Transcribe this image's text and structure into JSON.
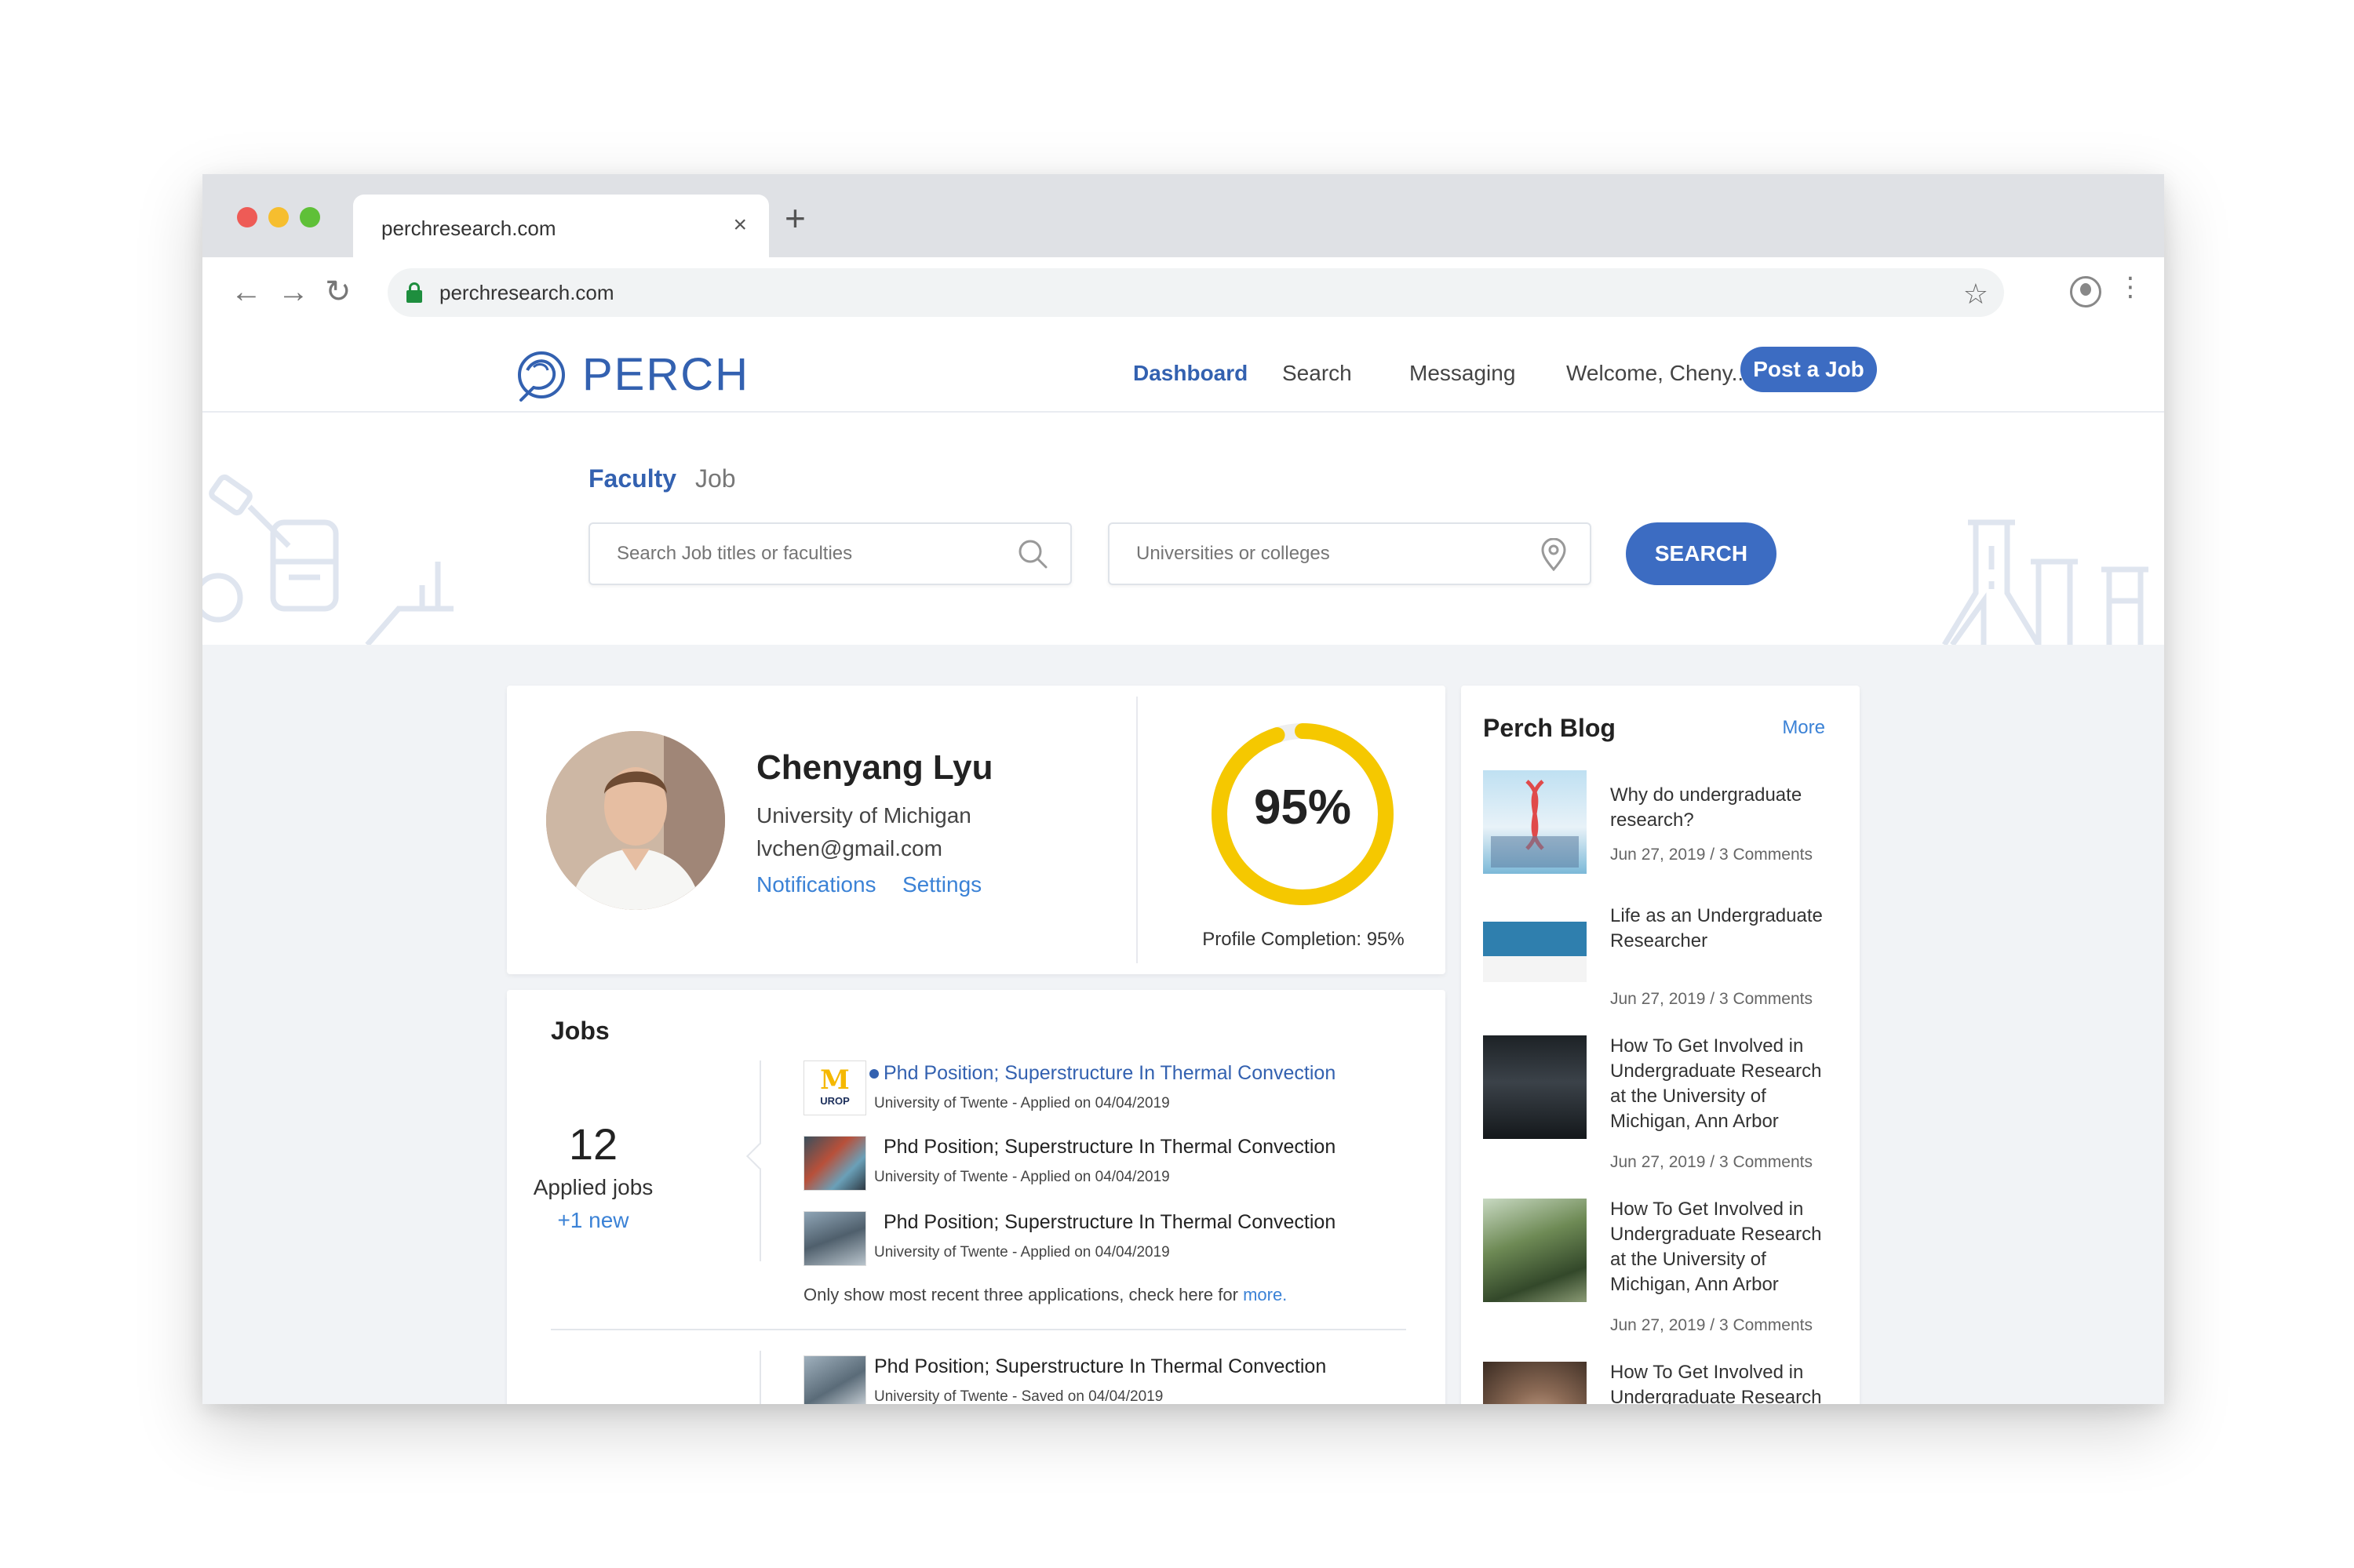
{
  "browser": {
    "tab_title": "perchresearch.com",
    "tab_close": "×",
    "new_tab": "+",
    "url": "perchresearch.com"
  },
  "header": {
    "logo_text": "PERCH",
    "nav": {
      "dashboard": "Dashboard",
      "search": "Search",
      "messaging": "Messaging",
      "welcome": "Welcome, Cheny..."
    },
    "post_job": "Post a Job"
  },
  "search": {
    "tab_faculty": "Faculty",
    "tab_job": "Job",
    "query_placeholder": "Search Job titles or faculties",
    "location_placeholder": "Universities or colleges",
    "button": "SEARCH"
  },
  "profile": {
    "name": "Chenyang Lyu",
    "university": "University of Michigan",
    "email": "lvchen@gmail.com",
    "notifications": "Notifications",
    "settings": "Settings",
    "completion_percent": 95,
    "completion_display": "95%",
    "completion_label": "Profile Completion: 95%"
  },
  "jobs": {
    "title": "Jobs",
    "applied_count": "12",
    "applied_label": "Applied jobs",
    "new_label": "+1 new",
    "applied": [
      {
        "title": "Phd Position; Superstructure In Thermal Convection",
        "meta": "University of Twente - Applied on 04/04/2019",
        "unread": true,
        "logo_text": "M",
        "logo_sub": "UROP"
      },
      {
        "title": "Phd Position; Superstructure In Thermal Convection",
        "meta": "University of Twente - Applied on 04/04/2019",
        "unread": false
      },
      {
        "title": "Phd Position; Superstructure In Thermal Convection",
        "meta": "University of Twente - Applied on 04/04/2019",
        "unread": false
      }
    ],
    "note": "Only show most recent three applications, check here for",
    "note_link": "more.",
    "saved": [
      {
        "title": "Phd Position; Superstructure In Thermal Convection",
        "meta": "University of Twente - Saved on 04/04/2019"
      }
    ]
  },
  "blog": {
    "title": "Perch Blog",
    "more": "More",
    "posts": [
      {
        "title": "Why do undergraduate research?",
        "meta": "Jun 27, 2019 / 3 Comments"
      },
      {
        "title": "Life as an Undergraduate Researcher",
        "meta": "Jun 27, 2019 / 3 Comments"
      },
      {
        "title": "How To Get Involved in Undergraduate Research at the University of Michigan, Ann Arbor",
        "meta": "Jun 27, 2019 / 3 Comments"
      },
      {
        "title": "How To Get Involved in Undergraduate Research at the University of Michigan, Ann Arbor",
        "meta": "Jun 27, 2019 / 3 Comments"
      },
      {
        "title": "How To Get Involved in Undergraduate Research",
        "meta": ""
      }
    ]
  },
  "colors": {
    "brand": "#3361b0",
    "accent": "#3c6cc2",
    "link": "#3b82d6",
    "progress": "#f5c800"
  }
}
